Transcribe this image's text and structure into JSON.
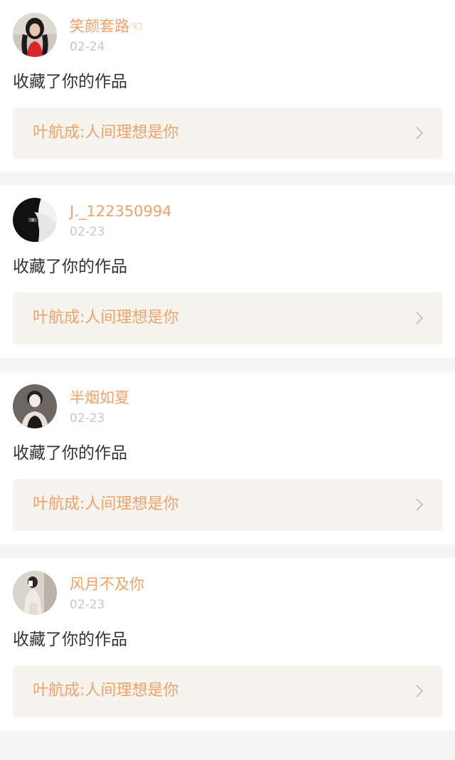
{
  "notifications": [
    {
      "avatar_icon": "user-avatar-icon",
      "username": "笑颜套路☜",
      "date": "02-24",
      "action": "收藏了你的作品",
      "work_title": "叶航成:人间理想是你"
    },
    {
      "avatar_icon": "user-avatar-icon",
      "username": "J._122350994",
      "date": "02-23",
      "action": "收藏了你的作品",
      "work_title": "叶航成:人间理想是你"
    },
    {
      "avatar_icon": "user-avatar-icon",
      "username": "半烟如夏",
      "date": "02-23",
      "action": "收藏了你的作品",
      "work_title": "叶航成:人间理想是你"
    },
    {
      "avatar_icon": "user-avatar-icon",
      "username": "风月不及你",
      "date": "02-23",
      "action": "收藏了你的作品",
      "work_title": "叶航成:人间理想是你"
    }
  ],
  "colors": {
    "accent": "#f0a26a",
    "date": "#c7c7c7",
    "action_text": "#333333",
    "work_box_bg": "#f5f4ee",
    "page_bg": "#f5f5f5"
  }
}
